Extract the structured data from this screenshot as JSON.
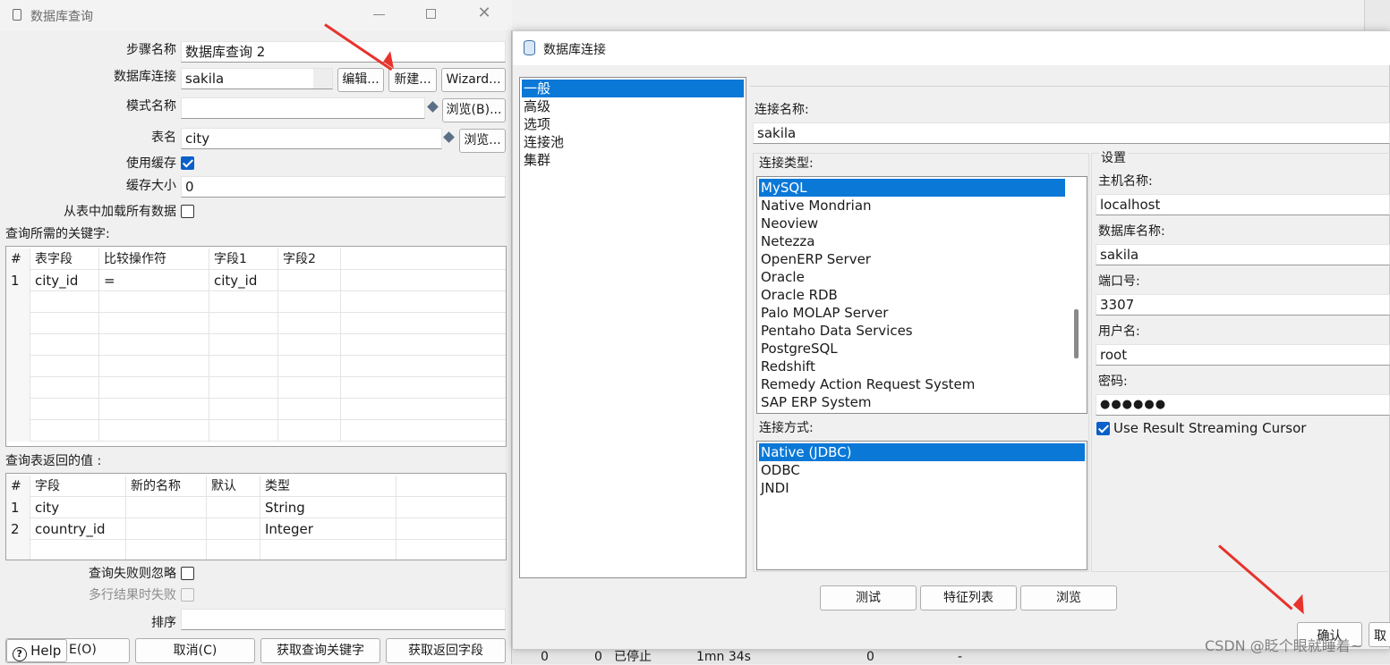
{
  "query_dialog": {
    "title": "数据库查询",
    "labels": {
      "step_name": "步骤名称",
      "db_connection": "数据库连接",
      "schema_name": "模式名称",
      "table_name": "表名",
      "use_cache": "使用缓存",
      "cache_size": "缓存大小",
      "load_all": "从表中加载所有数据",
      "keys_section": "查询所需的关键字:",
      "return_section": "查询表返回的值 :",
      "fail_ignore": "查询失败则忽略",
      "multi_fail": "多行结果时失败",
      "sort": "排序"
    },
    "values": {
      "step_name": "数据库查询 2",
      "db_connection": "sakila",
      "schema_name": "",
      "table_name": "city",
      "cache_size": "0",
      "sort": ""
    },
    "buttons": {
      "edit": "编辑...",
      "new": "新建...",
      "wizard": "Wizard...",
      "browse_schema": "浏览(B)...",
      "browse_table": "浏览...",
      "help": "Help",
      "ok_partial": "E(O)",
      "cancel": "取消(C)",
      "get_keys": "获取查询关键字",
      "get_return": "获取返回字段"
    },
    "keys_table": {
      "headers": [
        "#",
        "表字段",
        "比较操作符",
        "字段1",
        "字段2"
      ],
      "rows": [
        [
          "1",
          "city_id",
          "=",
          "city_id",
          ""
        ]
      ]
    },
    "return_table": {
      "headers": [
        "#",
        "字段",
        "新的名称",
        "默认",
        "类型"
      ],
      "rows": [
        [
          "1",
          "city",
          "",
          "",
          "String"
        ],
        [
          "2",
          "country_id",
          "",
          "",
          "Integer"
        ]
      ]
    }
  },
  "conn_dialog": {
    "title": "数据库连接",
    "nav_items": [
      "一般",
      "高级",
      "选项",
      "连接池",
      "集群"
    ],
    "conn_name_label": "连接名称:",
    "conn_name_value": "sakila",
    "conn_type_label": "连接类型:",
    "conn_types": [
      "MySQL",
      "Native Mondrian",
      "Neoview",
      "Netezza",
      "OpenERP Server",
      "Oracle",
      "Oracle RDB",
      "Palo MOLAP Server",
      "Pentaho Data Services",
      "PostgreSQL",
      "Redshift",
      "Remedy Action Request System",
      "SAP ERP System"
    ],
    "access_label": "连接方式:",
    "access_types": [
      "Native (JDBC)",
      "ODBC",
      "JNDI"
    ],
    "settings_label": "设置",
    "host_label": "主机名称:",
    "host_value": "localhost",
    "dbname_label": "数据库名称:",
    "dbname_value": "sakila",
    "port_label": "端口号:",
    "port_value": "3307",
    "user_label": "用户名:",
    "user_value": "root",
    "password_label": "密码:",
    "password_value": "●●●●●●",
    "streaming_label": "Use Result Streaming Cursor",
    "buttons": {
      "test": "测试",
      "features": "特征列表",
      "browse": "浏览",
      "confirm": "确认",
      "cancel_partial": "取"
    }
  },
  "background_row": [
    "0",
    "0",
    "已停止",
    "1mn 34s",
    "0",
    "-"
  ],
  "watermark": "CSDN @眨个眼就睡着~",
  "colors": {
    "selection": "#0a78d7",
    "checkbox": "#0b5fc8",
    "arrow": "#e8322c"
  }
}
